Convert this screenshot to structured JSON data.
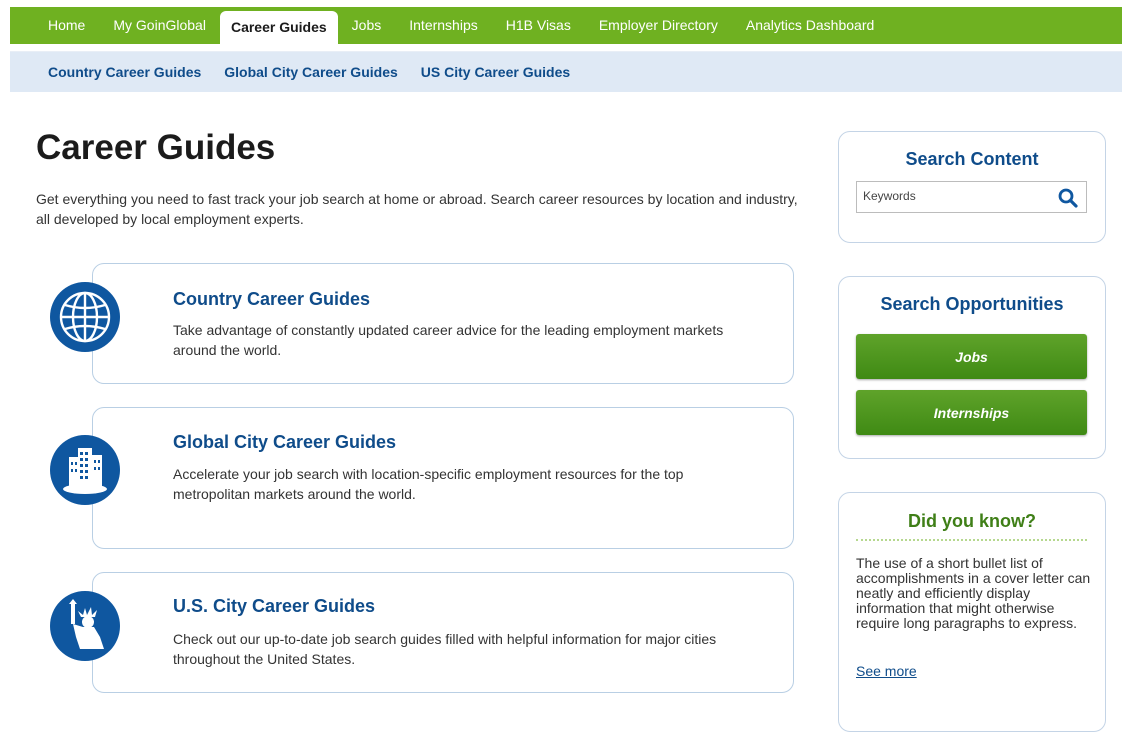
{
  "topnav": {
    "items": [
      {
        "label": "Home",
        "active": false
      },
      {
        "label": "My GoinGlobal",
        "active": false
      },
      {
        "label": "Career Guides",
        "active": true
      },
      {
        "label": "Jobs",
        "active": false
      },
      {
        "label": "Internships",
        "active": false
      },
      {
        "label": "H1B Visas",
        "active": false
      },
      {
        "label": "Employer Directory",
        "active": false
      },
      {
        "label": "Analytics Dashboard",
        "active": false
      }
    ]
  },
  "subnav": {
    "items": [
      "Country Career Guides",
      "Global City Career Guides",
      "US City Career Guides"
    ]
  },
  "main": {
    "title": "Career Guides",
    "intro": "Get everything you need to fast track your job search at home or abroad. Search career resources by location and industry, all developed by local employment experts.",
    "cards": [
      {
        "title": "Country Career Guides",
        "description": "Take advantage of constantly updated career advice for the leading employment markets around the world.",
        "icon": "globe-icon"
      },
      {
        "title": "Global City Career Guides",
        "description": "Accelerate your job search with location-specific employment resources for the top metropolitan markets around the world.",
        "icon": "skyscraper-icon"
      },
      {
        "title": "U.S. City Career Guides",
        "description": "Check out our up-to-date job search guides filled with helpful information for major cities throughout the United States.",
        "icon": "statue-of-liberty-icon"
      }
    ]
  },
  "sidebar": {
    "search_content": {
      "title": "Search Content",
      "placeholder": "Keywords",
      "icon": "search-icon"
    },
    "search_opportunities": {
      "title": "Search Opportunities",
      "buttons": [
        "Jobs",
        "Internships"
      ]
    },
    "did_you_know": {
      "title": "Did you know?",
      "text": "The use of a short bullet list of accomplishments in a cover letter can neatly and efficiently display information that might otherwise require long paragraphs to express.",
      "link": "See more"
    }
  },
  "colors": {
    "nav_green": "#6fb121",
    "subnav_bg": "#dfe9f5",
    "link_blue": "#0f4c8a",
    "icon_blue": "#0f57a0",
    "button_green": "#4d9720",
    "dyk_green": "#3f7f17"
  }
}
